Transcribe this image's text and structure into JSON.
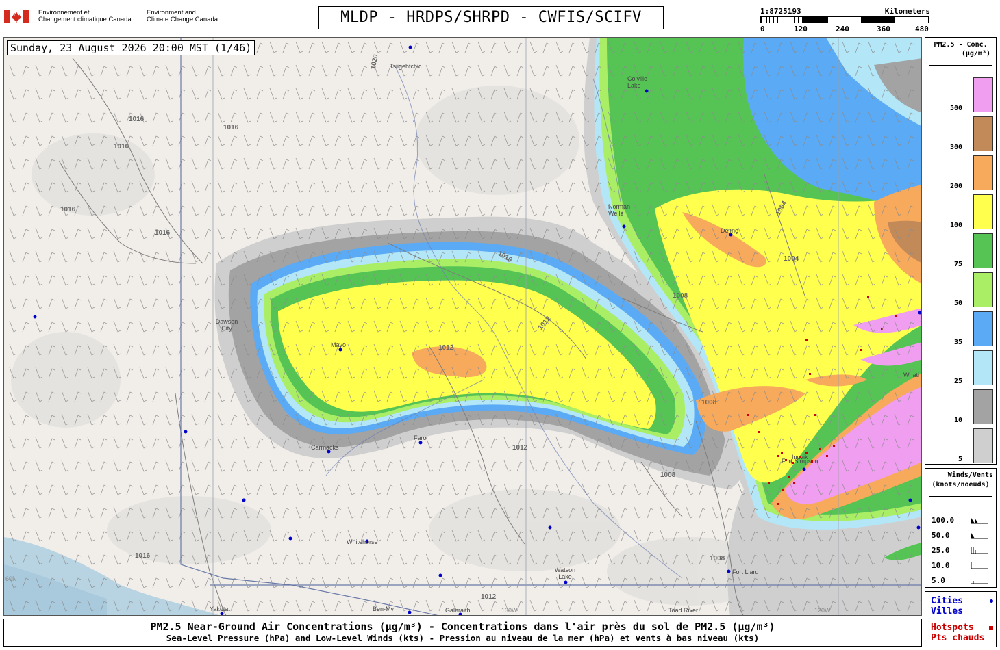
{
  "header": {
    "gov_fr_line1": "Environnement et",
    "gov_fr_line2": "Changement climatique Canada",
    "gov_en_line1": "Environment and",
    "gov_en_line2": "Climate Change Canada",
    "title": "MLDP - HRDPS/SHRPD - CWFIS/SCIFV"
  },
  "scale": {
    "ratio": "1:8725193",
    "units": "Kilometers",
    "ticks": [
      "0",
      "120",
      "240",
      "360",
      "480"
    ]
  },
  "map": {
    "timestamp": "Sunday, 23 August 2026 20:00 MST (1/46)",
    "place_labels": [
      {
        "name": "Tsiigehtchic",
        "color": "#444"
      },
      {
        "name": "Colville Lake",
        "color": "#444"
      },
      {
        "name": "Norman Wells",
        "color": "#444"
      },
      {
        "name": "Délı̨nę",
        "color": "#444"
      },
      {
        "name": "Dawson City",
        "color": "#444"
      },
      {
        "name": "Mayo",
        "color": "#444"
      },
      {
        "name": "Carmacks",
        "color": "#444"
      },
      {
        "name": "Faro",
        "color": "#444"
      },
      {
        "name": "Whitehorse",
        "color": "#444"
      },
      {
        "name": "Watson Lake",
        "color": "#444"
      },
      {
        "name": "Fort Liard",
        "color": "#444"
      },
      {
        "name": "Yakutat",
        "color": "#444"
      },
      {
        "name": "Ben-My",
        "color": "#444"
      },
      {
        "name": "Galbraith",
        "color": "#444"
      },
      {
        "name": "Toad River",
        "color": "#444"
      },
      {
        "name": "Whati",
        "color": "#444"
      },
      {
        "name": "Fort Simpson",
        "color": "#444"
      },
      {
        "name": "Inuvik",
        "color": "#444"
      }
    ],
    "isobar_labels": [
      "1020",
      "1016",
      "1012",
      "1008",
      "1004"
    ],
    "meridian_labels": [
      "130W",
      "120W"
    ],
    "parallel_labels": [
      "60N"
    ]
  },
  "legend_pm": {
    "title_line1": "PM2.5 - Conc.",
    "title_line2": "(μg/m³)",
    "levels": [
      {
        "label": "500",
        "color": "#f09ef0"
      },
      {
        "label": "300",
        "color": "#c28a58"
      },
      {
        "label": "200",
        "color": "#f7a95c"
      },
      {
        "label": "100",
        "color": "#ffff4d"
      },
      {
        "label": "75",
        "color": "#55c455"
      },
      {
        "label": "50",
        "color": "#aaee66"
      },
      {
        "label": "35",
        "color": "#5aaaf5"
      },
      {
        "label": "25",
        "color": "#b3e6f7"
      },
      {
        "label": "10",
        "color": "#a3a3a3"
      },
      {
        "label": "5",
        "color": "#cfcfcf"
      }
    ]
  },
  "legend_wind": {
    "title_line1": "Winds/Vents",
    "title_line2": "(knots/noeuds)",
    "rows": [
      {
        "value": "100.0",
        "icon": "wind-barb-100-icon"
      },
      {
        "value": "50.0",
        "icon": "wind-barb-50-icon"
      },
      {
        "value": "25.0",
        "icon": "wind-barb-25-icon"
      },
      {
        "value": "10.0",
        "icon": "wind-barb-10-icon"
      },
      {
        "value": "5.0",
        "icon": "wind-barb-5-icon"
      }
    ]
  },
  "legend_points": {
    "cities_en": "Cities",
    "cities_fr": "Villes",
    "hotspots_en": "Hotspots",
    "hotspots_fr": "Pts chauds",
    "city_color": "#0000cc",
    "hotspot_color": "#cc0000"
  },
  "caption": {
    "line1": "PM2.5 Near-Ground Air Concentrations (μg/m³) - Concentrations dans l'air près du sol de PM2.5 (μg/m³)",
    "line2": "Sea-Level Pressure (hPa) and Low-Level Winds (kts) - Pression au niveau de la mer (hPa) et vents à bas niveau (kts)"
  }
}
